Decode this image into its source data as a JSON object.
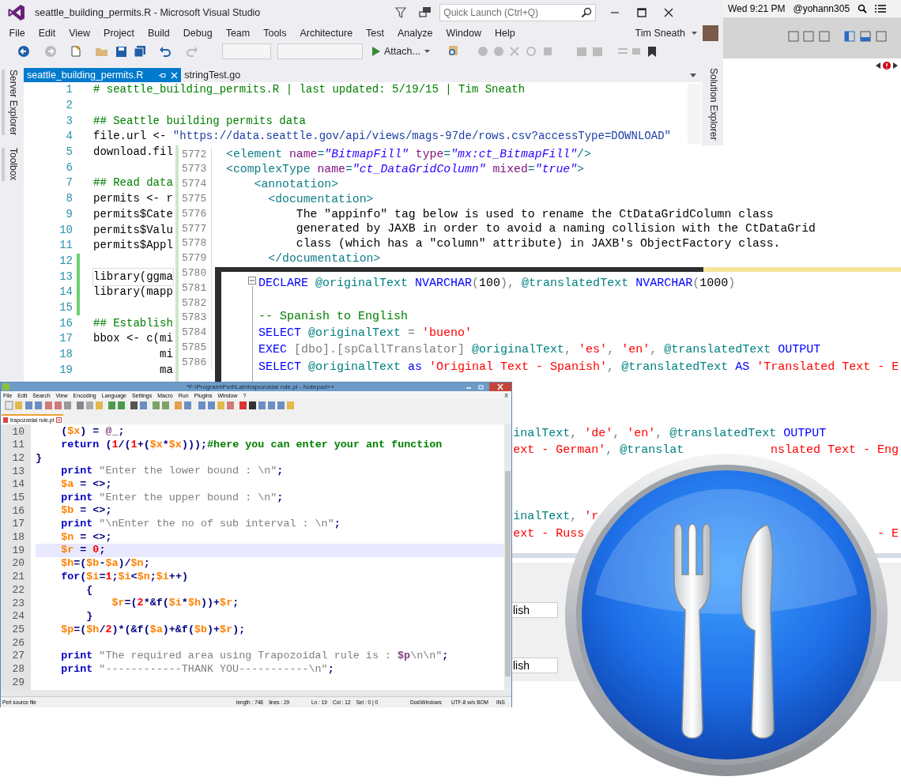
{
  "visual_studio": {
    "title": "seattle_building_permits.R - Microsoft Visual Studio",
    "quick_launch": {
      "placeholder": "Quick Launch (Ctrl+Q)"
    },
    "menu": [
      "File",
      "Edit",
      "View",
      "Project",
      "Build",
      "Debug",
      "Team",
      "Tools",
      "Architecture",
      "Test",
      "Analyze",
      "Window",
      "Help"
    ],
    "user": "Tim Sneath",
    "attach_button": "Attach...",
    "tabs": [
      {
        "label": "seattle_building_permits.R",
        "selected": true
      },
      {
        "label": "stringTest.go",
        "selected": false
      }
    ],
    "side_tabs_left": [
      "Server Explorer",
      "Toolbox"
    ],
    "side_tab_right": "Solution Explorer",
    "lines": [
      {
        "number": "1",
        "changed": false,
        "current": false,
        "tokens": [
          {
            "kind": "cm",
            "text": "# seattle_building_permits.R | last updated: 5/19/15 | Tim Sneath"
          }
        ]
      },
      {
        "number": "2",
        "changed": false,
        "current": false
      },
      {
        "number": "3",
        "changed": false,
        "current": false,
        "tokens": [
          {
            "kind": "cm",
            "text": "## Seattle building permits data"
          }
        ]
      },
      {
        "number": "4",
        "changed": false,
        "current": false,
        "tokens": [
          {
            "kind": "pl",
            "text": "file.url <- "
          },
          {
            "kind": "str",
            "text": "\"https://data.seattle.gov/api/views/mags-97de/rows.csv?accessType=DOWNLOAD\""
          }
        ]
      },
      {
        "number": "5",
        "changed": false,
        "current": false,
        "tokens": [
          {
            "kind": "pl",
            "text": "download.fil"
          }
        ]
      },
      {
        "number": "6",
        "changed": false,
        "current": false
      },
      {
        "number": "7",
        "changed": false,
        "current": false,
        "tokens": [
          {
            "kind": "cm",
            "text": "## Read data"
          }
        ]
      },
      {
        "number": "8",
        "changed": false,
        "current": false,
        "tokens": [
          {
            "kind": "pl",
            "text": "permits <- r"
          }
        ]
      },
      {
        "number": "9",
        "changed": false,
        "current": false,
        "tokens": [
          {
            "kind": "pl",
            "text": "permits$Cate"
          }
        ]
      },
      {
        "number": "10",
        "changed": false,
        "current": false,
        "tokens": [
          {
            "kind": "pl",
            "text": "permits$Valu"
          }
        ]
      },
      {
        "number": "11",
        "changed": false,
        "current": false,
        "tokens": [
          {
            "kind": "pl",
            "text": "permits$Appl"
          }
        ]
      },
      {
        "number": "12",
        "changed": true,
        "current": false
      },
      {
        "number": "13",
        "changed": true,
        "current": true,
        "tokens": [
          {
            "kind": "pl",
            "text": "library(ggma"
          }
        ]
      },
      {
        "number": "14",
        "changed": true,
        "current": false,
        "tokens": [
          {
            "kind": "pl",
            "text": "library(mapp"
          }
        ]
      },
      {
        "number": "15",
        "changed": true,
        "current": false
      },
      {
        "number": "16",
        "changed": false,
        "current": false,
        "tokens": [
          {
            "kind": "cm",
            "text": "## Establish"
          }
        ]
      },
      {
        "number": "17",
        "changed": false,
        "current": false,
        "tokens": [
          {
            "kind": "pl",
            "text": "bbox <- c(mi"
          }
        ]
      },
      {
        "number": "18",
        "changed": false,
        "current": false,
        "tokens": [
          {
            "kind": "pl",
            "text": "          mi"
          }
        ]
      },
      {
        "number": "19",
        "changed": false,
        "current": false,
        "tokens": [
          {
            "kind": "pl",
            "text": "          ma"
          }
        ]
      }
    ]
  },
  "mac_menubar": {
    "clock": "Wed 9:21 PM",
    "user": "@yohann305"
  },
  "xml_editor": {
    "lines": [
      {
        "number": "5772",
        "tokens": [
          {
            "kind": "tag",
            "text": "<element "
          },
          {
            "kind": "attr",
            "text": "name"
          },
          {
            "kind": "tag",
            "text": "="
          },
          {
            "kind": "val",
            "text": "\"BitmapFill\""
          },
          {
            "kind": "attr",
            "text": " type"
          },
          {
            "kind": "tag",
            "text": "="
          },
          {
            "kind": "val",
            "text": "\"mx:ct_BitmapFill\""
          },
          {
            "kind": "tag",
            "text": "/>"
          }
        ]
      },
      {
        "number": "5773",
        "tokens": [
          {
            "kind": "tag",
            "text": "<complexType "
          },
          {
            "kind": "attr",
            "text": "name"
          },
          {
            "kind": "tag",
            "text": "="
          },
          {
            "kind": "val",
            "text": "\"ct_DataGridColumn\""
          },
          {
            "kind": "attr",
            "text": " mixed"
          },
          {
            "kind": "tag",
            "text": "="
          },
          {
            "kind": "val",
            "text": "\"true\""
          },
          {
            "kind": "tag",
            "text": ">"
          }
        ]
      },
      {
        "number": "5774",
        "tokens": [
          {
            "kind": "tag",
            "text": "    <annotation>"
          }
        ]
      },
      {
        "number": "5775",
        "tokens": [
          {
            "kind": "tag",
            "text": "      <documentation>"
          }
        ]
      },
      {
        "number": "5776",
        "tokens": [
          {
            "kind": "pl",
            "text": "          The \"appinfo\" tag below is used to rename the CtDataGridColumn class"
          }
        ]
      },
      {
        "number": "5777",
        "tokens": [
          {
            "kind": "pl",
            "text": "          generated by JAXB in order to avoid a naming collision with the CtDataGrid"
          }
        ]
      },
      {
        "number": "5778",
        "tokens": [
          {
            "kind": "pl",
            "text": "          class (which has a \"column\" attribute) in JAXB's ObjectFactory class."
          }
        ]
      },
      {
        "number": "5779",
        "tokens": [
          {
            "kind": "tag",
            "text": "      </documentation>"
          }
        ]
      },
      {
        "number": "5780"
      },
      {
        "number": "5781"
      },
      {
        "number": "5782"
      },
      {
        "number": "5783"
      },
      {
        "number": "5784"
      },
      {
        "number": "5785"
      },
      {
        "number": "5786"
      }
    ]
  },
  "sql_editor": {
    "lines": [
      {
        "fragments": [
          {
            "tokens": [
              {
                "kind": "kw",
                "text": "DECLARE "
              },
              {
                "kind": "var",
                "text": "@originalText "
              },
              {
                "kind": "kw",
                "text": "NVARCHAR"
              },
              {
                "kind": "pl",
                "text": "("
              },
              {
                "kind": "blk",
                "text": "100"
              },
              {
                "kind": "pl",
                "text": "), "
              },
              {
                "kind": "var",
                "text": "@translatedText "
              },
              {
                "kind": "kw",
                "text": "NVARCHAR"
              },
              {
                "kind": "pl",
                "text": "("
              },
              {
                "kind": "blk",
                "text": "1000"
              },
              {
                "kind": "pl",
                "text": ")"
              }
            ]
          }
        ]
      },
      {
        "fragments": [
          {
            "tokens": [
              {
                "kind": "cm",
                "text": "-- Spanish to English"
              }
            ]
          }
        ]
      },
      {
        "fragments": [
          {
            "tokens": [
              {
                "kind": "kw",
                "text": "SELECT "
              },
              {
                "kind": "var",
                "text": "@originalText "
              },
              {
                "kind": "pl",
                "text": "= "
              },
              {
                "kind": "str",
                "text": "'bueno'"
              }
            ]
          }
        ]
      },
      {
        "fragments": [
          {
            "tokens": [
              {
                "kind": "kw",
                "text": "EXEC "
              },
              {
                "kind": "pl",
                "text": "[dbo].[spCallTranslator] "
              },
              {
                "kind": "var",
                "text": "@originalText"
              },
              {
                "kind": "pl",
                "text": ", "
              },
              {
                "kind": "str",
                "text": "'es'"
              },
              {
                "kind": "pl",
                "text": ", "
              },
              {
                "kind": "str",
                "text": "'en'"
              },
              {
                "kind": "pl",
                "text": ", "
              },
              {
                "kind": "var",
                "text": "@translatedText "
              },
              {
                "kind": "kw",
                "text": "OUTPUT"
              }
            ]
          }
        ]
      },
      {
        "fragments": [
          {
            "tokens": [
              {
                "kind": "kw",
                "text": "SELECT "
              },
              {
                "kind": "var",
                "text": "@originalText "
              },
              {
                "kind": "kw",
                "text": "as "
              },
              {
                "kind": "str",
                "text": "'Original Text - Spanish'"
              },
              {
                "kind": "pl",
                "text": ", "
              },
              {
                "kind": "var",
                "text": "@translatedText "
              },
              {
                "kind": "kw",
                "text": "AS "
              },
              {
                "kind": "str",
                "text": "'Translated Text - E"
              }
            ]
          }
        ]
      },
      {
        "fragments": [
          {
            "tokens": [
              {
                "kind": "var",
                "text": "inalText"
              },
              {
                "kind": "pl",
                "text": ", "
              },
              {
                "kind": "str",
                "text": "'de'"
              },
              {
                "kind": "pl",
                "text": ", "
              },
              {
                "kind": "str",
                "text": "'en'"
              },
              {
                "kind": "pl",
                "text": ", "
              },
              {
                "kind": "var",
                "text": "@translatedText "
              },
              {
                "kind": "kw",
                "text": "OUTPUT"
              }
            ]
          }
        ]
      },
      {
        "fragments": [
          {
            "tokens": [
              {
                "kind": "str",
                "text": "ext - German'"
              },
              {
                "kind": "pl",
                "text": ", "
              },
              {
                "kind": "var",
                "text": "@translat"
              }
            ]
          },
          {
            "tokens": [
              {
                "kind": "str",
                "text": "nslated Text - Eng"
              }
            ]
          }
        ]
      },
      {
        "fragments": [
          {
            "tokens": [
              {
                "kind": "var",
                "text": "inalText"
              },
              {
                "kind": "pl",
                "text": ", "
              },
              {
                "kind": "str",
                "text": "'r"
              }
            ]
          }
        ]
      },
      {
        "fragments": [
          {
            "tokens": [
              {
                "kind": "str",
                "text": "ext - Russ"
              }
            ]
          },
          {
            "tokens": [
              {
                "kind": "str",
                "text": "- E"
              }
            ]
          }
        ]
      }
    ]
  },
  "results_grid": {
    "cells": [
      "lish",
      "lish"
    ]
  },
  "notepad_pp": {
    "title": "*F:\\Program\\Perl\\Lab\\trapozoidal rule.pl - Notepad++",
    "menu": [
      "File",
      "Edit",
      "Search",
      "View",
      "Encoding",
      "Language",
      "Settings",
      "Macro",
      "Run",
      "Plugins",
      "Window",
      "?"
    ],
    "close_tab_glyph": "X",
    "tab": "trapozoidal rule.pl",
    "lines": [
      {
        "number": "10",
        "current": false,
        "tokens": [
          {
            "kind": "op",
            "text": "    ("
          },
          {
            "kind": "var",
            "text": "$x"
          },
          {
            "kind": "op",
            "text": ") = "
          },
          {
            "kind": "sp",
            "text": "@_"
          },
          {
            "kind": "op",
            "text": ";"
          }
        ]
      },
      {
        "number": "11",
        "current": false,
        "tokens": [
          {
            "kind": "kw",
            "text": "    return "
          },
          {
            "kind": "op",
            "text": "("
          },
          {
            "kind": "num",
            "text": "1"
          },
          {
            "kind": "op",
            "text": "/("
          },
          {
            "kind": "num",
            "text": "1"
          },
          {
            "kind": "op",
            "text": "+("
          },
          {
            "kind": "var",
            "text": "$x"
          },
          {
            "kind": "op",
            "text": "*"
          },
          {
            "kind": "var",
            "text": "$x"
          },
          {
            "kind": "op",
            "text": ")));"
          },
          {
            "kind": "cm",
            "text": "#here you can enter your ant function"
          }
        ]
      },
      {
        "number": "12",
        "current": false,
        "tokens": [
          {
            "kind": "op",
            "text": "}"
          }
        ]
      },
      {
        "number": "13",
        "current": false,
        "tokens": [
          {
            "kind": "kw",
            "text": "    print "
          },
          {
            "kind": "str",
            "text": "\"Enter the lower bound : \\n\""
          },
          {
            "kind": "op",
            "text": ";"
          }
        ]
      },
      {
        "number": "14",
        "current": false,
        "tokens": [
          {
            "kind": "var",
            "text": "    $a"
          },
          {
            "kind": "op",
            "text": " = <>;"
          }
        ]
      },
      {
        "number": "15",
        "current": false,
        "tokens": [
          {
            "kind": "kw",
            "text": "    print "
          },
          {
            "kind": "str",
            "text": "\"Enter the upper bound : \\n\""
          },
          {
            "kind": "op",
            "text": ";"
          }
        ]
      },
      {
        "number": "16",
        "current": false,
        "tokens": [
          {
            "kind": "var",
            "text": "    $b"
          },
          {
            "kind": "op",
            "text": " = <>;"
          }
        ]
      },
      {
        "number": "17",
        "current": false,
        "tokens": [
          {
            "kind": "kw",
            "text": "    print "
          },
          {
            "kind": "str",
            "text": "\"\\nEnter the no of sub interval : \\n\""
          },
          {
            "kind": "op",
            "text": ";"
          }
        ]
      },
      {
        "number": "18",
        "current": false,
        "tokens": [
          {
            "kind": "var",
            "text": "    $n"
          },
          {
            "kind": "op",
            "text": " = <>;"
          }
        ]
      },
      {
        "number": "19",
        "current": true,
        "tokens": [
          {
            "kind": "var",
            "text": "    $r"
          },
          {
            "kind": "op",
            "text": " = "
          },
          {
            "kind": "num",
            "text": "0"
          },
          {
            "kind": "op",
            "text": ";"
          }
        ]
      },
      {
        "number": "20",
        "current": false,
        "tokens": [
          {
            "kind": "var",
            "text": "    $h"
          },
          {
            "kind": "op",
            "text": "=("
          },
          {
            "kind": "var",
            "text": "$b"
          },
          {
            "kind": "op",
            "text": "-"
          },
          {
            "kind": "var",
            "text": "$a"
          },
          {
            "kind": "op",
            "text": ")/"
          },
          {
            "kind": "var",
            "text": "$n"
          },
          {
            "kind": "op",
            "text": ";"
          }
        ]
      },
      {
        "number": "21",
        "current": false,
        "tokens": [
          {
            "kind": "kw",
            "text": "    for"
          },
          {
            "kind": "op",
            "text": "("
          },
          {
            "kind": "var",
            "text": "$i"
          },
          {
            "kind": "op",
            "text": "="
          },
          {
            "kind": "num",
            "text": "1"
          },
          {
            "kind": "op",
            "text": ";"
          },
          {
            "kind": "var",
            "text": "$i"
          },
          {
            "kind": "op",
            "text": "<"
          },
          {
            "kind": "var",
            "text": "$n"
          },
          {
            "kind": "op",
            "text": ";"
          },
          {
            "kind": "var",
            "text": "$i"
          },
          {
            "kind": "op",
            "text": "++)"
          }
        ]
      },
      {
        "number": "22",
        "current": false,
        "tokens": [
          {
            "kind": "op",
            "text": "        {"
          }
        ]
      },
      {
        "number": "23",
        "current": false,
        "tokens": [
          {
            "kind": "var",
            "text": "            $r"
          },
          {
            "kind": "op",
            "text": "=("
          },
          {
            "kind": "num",
            "text": "2"
          },
          {
            "kind": "op",
            "text": "*&f("
          },
          {
            "kind": "var",
            "text": "$i"
          },
          {
            "kind": "op",
            "text": "*"
          },
          {
            "kind": "var",
            "text": "$h"
          },
          {
            "kind": "op",
            "text": "))+"
          },
          {
            "kind": "var",
            "text": "$r"
          },
          {
            "kind": "op",
            "text": ";"
          }
        ]
      },
      {
        "number": "24",
        "current": false,
        "tokens": [
          {
            "kind": "op",
            "text": "        }"
          }
        ]
      },
      {
        "number": "25",
        "current": false,
        "tokens": [
          {
            "kind": "var",
            "text": "    $p"
          },
          {
            "kind": "op",
            "text": "=("
          },
          {
            "kind": "var",
            "text": "$h"
          },
          {
            "kind": "op",
            "text": "/"
          },
          {
            "kind": "num",
            "text": "2"
          },
          {
            "kind": "op",
            "text": ")*(&f("
          },
          {
            "kind": "var",
            "text": "$a"
          },
          {
            "kind": "op",
            "text": ")+&f("
          },
          {
            "kind": "var",
            "text": "$b"
          },
          {
            "kind": "op",
            "text": ")+"
          },
          {
            "kind": "var",
            "text": "$r"
          },
          {
            "kind": "op",
            "text": ");"
          }
        ]
      },
      {
        "number": "26",
        "current": false
      },
      {
        "number": "27",
        "current": false,
        "tokens": [
          {
            "kind": "kw",
            "text": "    print "
          },
          {
            "kind": "str",
            "text": "\"The required area using Trapozoidal rule is : "
          },
          {
            "kind": "sp",
            "text": "$p"
          },
          {
            "kind": "str",
            "text": "\\n\\n\""
          },
          {
            "kind": "op",
            "text": ";"
          }
        ]
      },
      {
        "number": "28",
        "current": false,
        "tokens": [
          {
            "kind": "kw",
            "text": "    print "
          },
          {
            "kind": "str",
            "text": "\"------------THANK YOU-----------\\n\""
          },
          {
            "kind": "op",
            "text": ";"
          }
        ]
      },
      {
        "number": "29",
        "current": false
      }
    ],
    "status": [
      "Perl source file",
      "length : 748    lines : 29",
      "Ln : 19    Col : 12    Sel : 0 | 0",
      "Dos\\Windows",
      "UTF-8 w/o BOM",
      "INS"
    ]
  }
}
